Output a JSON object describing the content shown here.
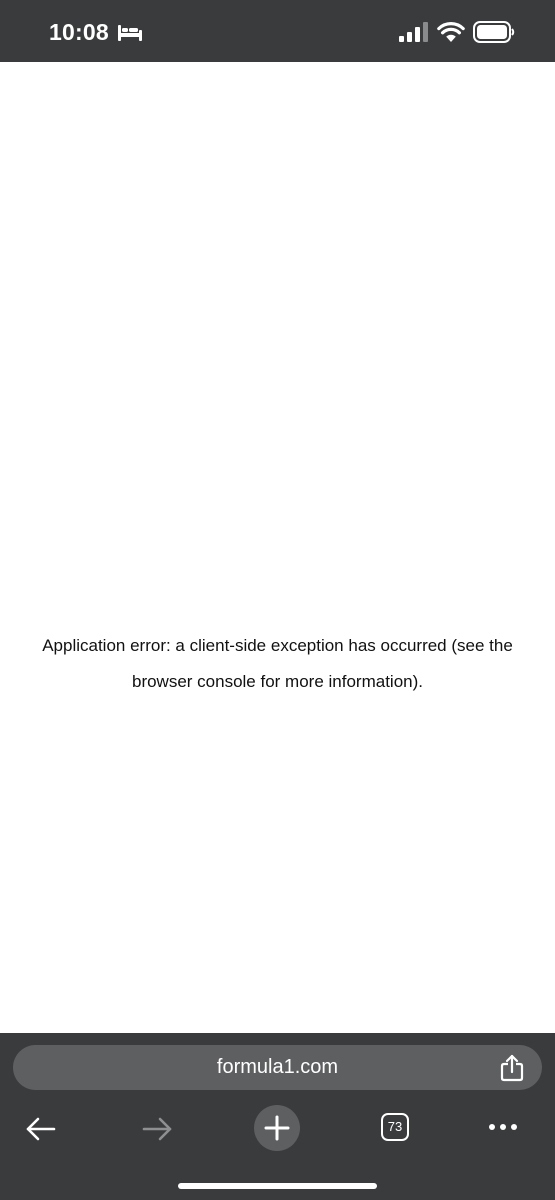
{
  "status_bar": {
    "time": "10:08",
    "icons": [
      "sleep-mode-icon",
      "cellular-signal-icon",
      "wifi-icon",
      "battery-icon"
    ]
  },
  "page": {
    "error_line_1": "Application error: a client-side exception has occurred (see the",
    "error_line_2": "browser console for more information)."
  },
  "browser": {
    "address": "formula1.com",
    "tab_count": "73",
    "icons": [
      "share-icon",
      "back-arrow-icon",
      "forward-arrow-icon",
      "plus-icon",
      "tabs-icon",
      "more-icon"
    ]
  },
  "colors": {
    "chrome_background": "#3a3b3d",
    "address_bar": "#5d5f61",
    "page_background": "#ffffff",
    "text": "#111111",
    "disabled_icon": "#8e8f91"
  }
}
